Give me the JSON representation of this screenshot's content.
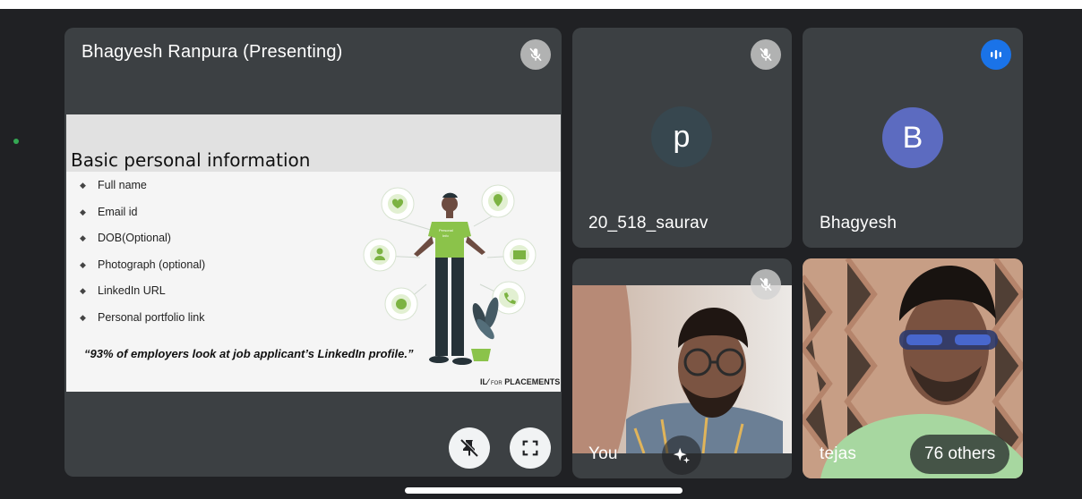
{
  "presenter": {
    "name": "Bhagyesh Ranpura (Presenting)",
    "mic_icon": "mic-off-icon",
    "controls": [
      "unpin-icon",
      "fullscreen-icon"
    ]
  },
  "slide": {
    "title": "Basic personal information",
    "bullets": [
      "Full name",
      "Email id",
      "DOB(Optional)",
      "Photograph (optional)",
      "LinkedIn URL",
      "Personal portfolio link"
    ],
    "quote": "“93% of employers look at job applicant’s LinkedIn profile.”",
    "brand_mark": "IL",
    "brand_small": "FOR",
    "brand_big": "PLACEMENTS",
    "figure_shirt_text": "Personal Info"
  },
  "participants": [
    {
      "name": "20_518_saurav",
      "avatar_letter": "p",
      "avatar_color": "#37474f",
      "mic": "mic-off-icon"
    },
    {
      "name": "Bhagyesh",
      "avatar_letter": "B",
      "avatar_color": "#5c6bc0",
      "mic": "speaking-icon"
    },
    {
      "name": "You",
      "mic": "mic-off-icon",
      "effect": "sparkle-effects-icon"
    },
    {
      "name": "tejas"
    }
  ],
  "others_label": "76 others",
  "colors": {
    "speaking": "#1a73e8",
    "tile": "#3c4043",
    "background": "#202124",
    "accent_green": "#8bc34a"
  }
}
